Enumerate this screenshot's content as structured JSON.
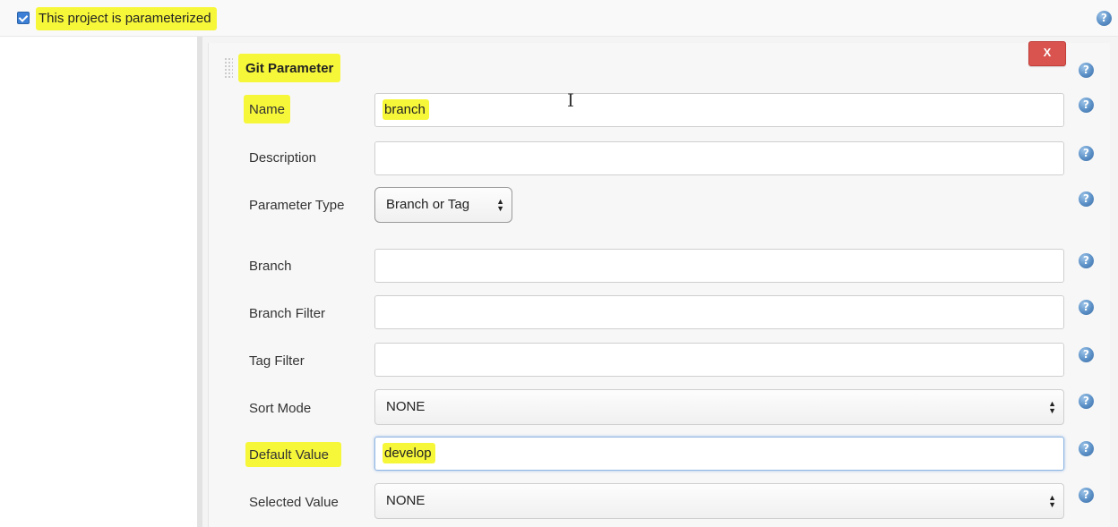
{
  "project": {
    "parameterized_label": "This project is parameterized",
    "checked": true
  },
  "parameter": {
    "title": "Git Parameter",
    "remove_label": "X",
    "fields": {
      "name": {
        "label": "Name",
        "value": "branch"
      },
      "description": {
        "label": "Description",
        "value": ""
      },
      "parameter_type": {
        "label": "Parameter Type",
        "value": "Branch or Tag"
      },
      "branch": {
        "label": "Branch",
        "value": ""
      },
      "branch_filter": {
        "label": "Branch Filter",
        "value": ""
      },
      "tag_filter": {
        "label": "Tag Filter",
        "value": ""
      },
      "sort_mode": {
        "label": "Sort Mode",
        "value": "NONE"
      },
      "default_value": {
        "label": "Default Value",
        "value": "develop"
      },
      "selected_value": {
        "label": "Selected Value",
        "value": "NONE"
      }
    }
  },
  "help_glyph": "?",
  "colors": {
    "highlight": "#f7f73a",
    "remove_button": "#d9534f",
    "help_icon": "#5a8fc6"
  },
  "icons": [
    "checkbox-checked-icon",
    "help-icon",
    "drag-handle-icon",
    "text-cursor-icon",
    "select-arrows-icon"
  ]
}
